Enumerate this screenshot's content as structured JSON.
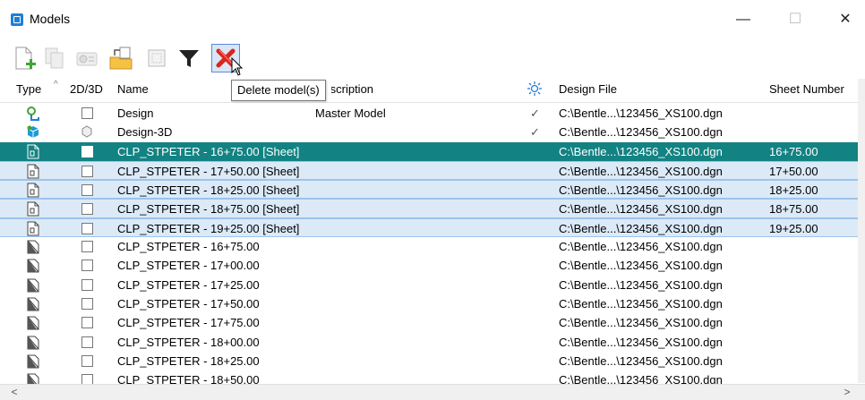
{
  "window": {
    "title": "Models",
    "minimize": "—",
    "maximize": "☐",
    "close": "✕"
  },
  "toolbar": {
    "buttons": [
      "new-model",
      "copy-model",
      "model-properties",
      "import-model",
      "update-thumbnail",
      "filter",
      "delete-model"
    ],
    "tooltip": "Delete model(s)"
  },
  "columns": {
    "type": "Type",
    "dim": "2D/3D",
    "name": "Name",
    "description": "Description",
    "design_file": "Design File",
    "sheet_number": "Sheet Number"
  },
  "rows": [
    {
      "type": "design",
      "name": "Design",
      "description": "Master Model",
      "check": "✓",
      "file": "C:\\Bentle...\\123456_XS100.dgn",
      "sheet": "",
      "state": ""
    },
    {
      "type": "design3d",
      "name": "Design-3D",
      "description": "",
      "check": "✓",
      "file": "C:\\Bentle...\\123456_XS100.dgn",
      "sheet": "",
      "state": ""
    },
    {
      "type": "sheet",
      "name": "CLP_STPETER - 16+75.00 [Sheet]",
      "description": "",
      "check": "",
      "file": "C:\\Bentle...\\123456_XS100.dgn",
      "sheet": "16+75.00",
      "state": "focus"
    },
    {
      "type": "sheet",
      "name": "CLP_STPETER - 17+50.00 [Sheet]",
      "description": "",
      "check": "",
      "file": "C:\\Bentle...\\123456_XS100.dgn",
      "sheet": "17+50.00",
      "state": "sel"
    },
    {
      "type": "sheet",
      "name": "CLP_STPETER - 18+25.00 [Sheet]",
      "description": "",
      "check": "",
      "file": "C:\\Bentle...\\123456_XS100.dgn",
      "sheet": "18+25.00",
      "state": "sel"
    },
    {
      "type": "sheet",
      "name": "CLP_STPETER - 18+75.00 [Sheet]",
      "description": "",
      "check": "",
      "file": "C:\\Bentle...\\123456_XS100.dgn",
      "sheet": "18+75.00",
      "state": "sel"
    },
    {
      "type": "sheet",
      "name": "CLP_STPETER - 19+25.00 [Sheet]",
      "description": "",
      "check": "",
      "file": "C:\\Bentle...\\123456_XS100.dgn",
      "sheet": "19+25.00",
      "state": "sel"
    },
    {
      "type": "drawing",
      "name": "CLP_STPETER - 16+75.00",
      "description": "",
      "check": "",
      "file": "C:\\Bentle...\\123456_XS100.dgn",
      "sheet": "",
      "state": ""
    },
    {
      "type": "drawing",
      "name": "CLP_STPETER - 17+00.00",
      "description": "",
      "check": "",
      "file": "C:\\Bentle...\\123456_XS100.dgn",
      "sheet": "",
      "state": ""
    },
    {
      "type": "drawing",
      "name": "CLP_STPETER - 17+25.00",
      "description": "",
      "check": "",
      "file": "C:\\Bentle...\\123456_XS100.dgn",
      "sheet": "",
      "state": ""
    },
    {
      "type": "drawing",
      "name": "CLP_STPETER - 17+50.00",
      "description": "",
      "check": "",
      "file": "C:\\Bentle...\\123456_XS100.dgn",
      "sheet": "",
      "state": ""
    },
    {
      "type": "drawing",
      "name": "CLP_STPETER - 17+75.00",
      "description": "",
      "check": "",
      "file": "C:\\Bentle...\\123456_XS100.dgn",
      "sheet": "",
      "state": ""
    },
    {
      "type": "drawing",
      "name": "CLP_STPETER - 18+00.00",
      "description": "",
      "check": "",
      "file": "C:\\Bentle...\\123456_XS100.dgn",
      "sheet": "",
      "state": ""
    },
    {
      "type": "drawing",
      "name": "CLP_STPETER - 18+25.00",
      "description": "",
      "check": "",
      "file": "C:\\Bentle...\\123456_XS100.dgn",
      "sheet": "",
      "state": ""
    },
    {
      "type": "drawing",
      "name": "CLP_STPETER - 18+50.00",
      "description": "",
      "check": "",
      "file": "C:\\Bentle...\\123456_XS100.dgn",
      "sheet": "",
      "state": ""
    }
  ],
  "colors": {
    "focus_row": "#138282",
    "selected_row": "#dceaf8",
    "delete_icon": "#d9251c"
  }
}
